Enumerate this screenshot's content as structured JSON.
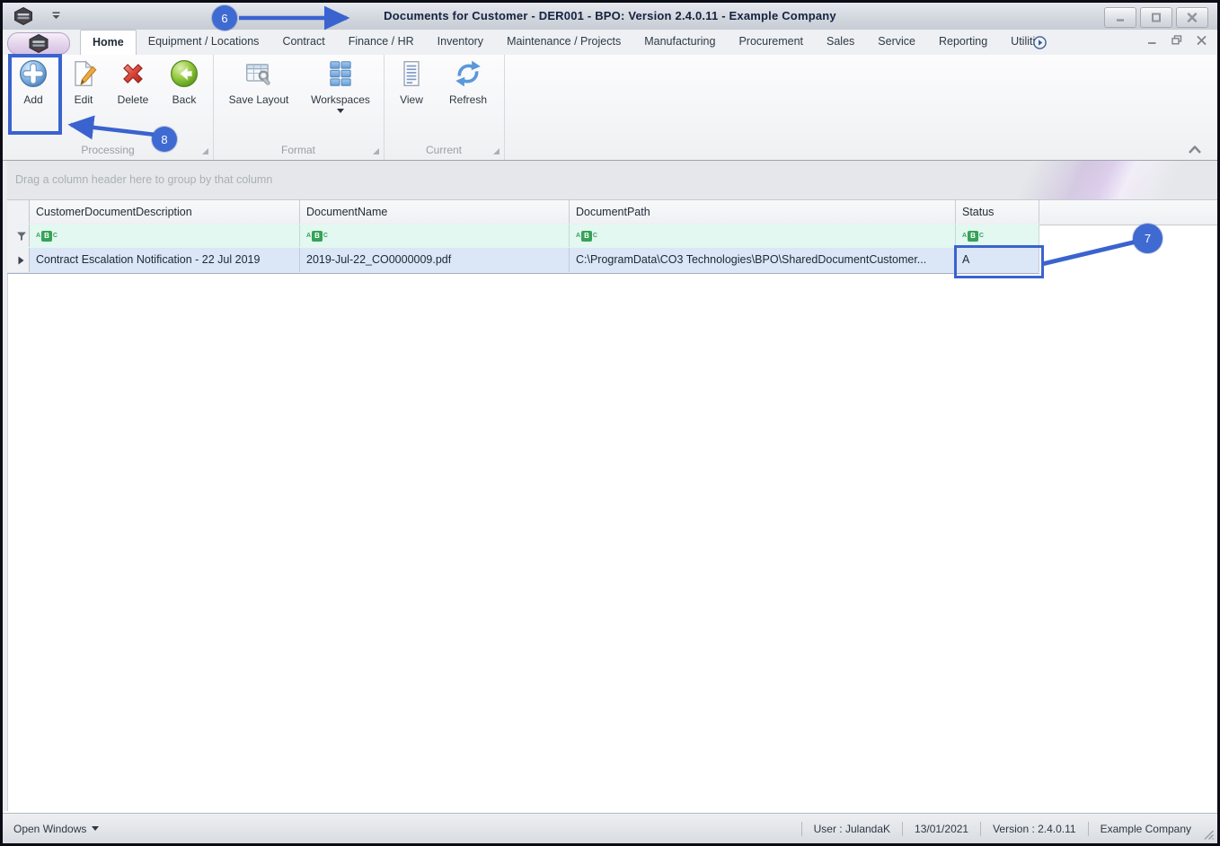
{
  "colors": {
    "annotation_blue": "#3a63cf",
    "filter_row_bg": "#e2f8f0",
    "selected_row_bg": "#dbe6f6",
    "filter_badge_green": "#36a257",
    "title_text": "#15233f",
    "window_frame": "#0c0c16"
  },
  "icons": {
    "app_logo": "bpo-hexagon-logo",
    "quick_access_caret": "chevron-down",
    "minimize": "minus-glyph",
    "maximize": "square-glyph",
    "close": "x-glyph",
    "tab_scroll": "circled-right-arrow",
    "add": "blue-sphere-plus",
    "edit": "page-with-pencil",
    "delete": "red-x",
    "back": "green-sphere-left-arrow",
    "save_layout": "table-with-wrench",
    "workspaces": "blue-tile-grid",
    "view": "document-lines",
    "refresh": "circular-arrows",
    "ribbon_collapse": "chevron-up",
    "filter_funnel": "funnel",
    "row_marker": "right-triangle",
    "abc_filter": "abc-badge",
    "resize_grip": "diagonal-grip"
  },
  "title_bar": {
    "title": "Documents for Customer - DER001 - BPO: Version 2.4.0.11 - Example Company"
  },
  "tabs": {
    "active": "Home",
    "items": [
      "Home",
      "Equipment / Locations",
      "Contract",
      "Finance / HR",
      "Inventory",
      "Maintenance / Projects",
      "Manufacturing",
      "Procurement",
      "Sales",
      "Service",
      "Reporting",
      "Utiliti"
    ]
  },
  "ribbon": {
    "groups": [
      {
        "label": "Processing",
        "buttons": [
          {
            "label": "Add"
          },
          {
            "label": "Edit"
          },
          {
            "label": "Delete"
          },
          {
            "label": "Back"
          }
        ]
      },
      {
        "label": "Format",
        "buttons": [
          {
            "label": "Save Layout"
          },
          {
            "label": "Workspaces"
          }
        ]
      },
      {
        "label": "Current",
        "buttons": [
          {
            "label": "View"
          },
          {
            "label": "Refresh"
          }
        ]
      }
    ]
  },
  "grid": {
    "group_by_hint": "Drag a column header here to group by that column",
    "columns": [
      "CustomerDocumentDescription",
      "DocumentName",
      "DocumentPath",
      "Status"
    ],
    "filter_badge": {
      "a": "A",
      "b": "B",
      "c": "C"
    },
    "rows": [
      {
        "customer_document_description": "Contract Escalation Notification - 22 Jul 2019",
        "document_name": "2019-Jul-22_CO0000009.pdf",
        "document_path": "C:\\ProgramData\\CO3 Technologies\\BPO\\SharedDocumentCustomer...",
        "status": "A"
      }
    ]
  },
  "status_bar": {
    "open_windows_label": "Open Windows",
    "items": [
      "User : JulandaK",
      "13/01/2021",
      "Version : 2.4.0.11",
      "Example Company"
    ]
  },
  "annotations": {
    "callouts": [
      "6",
      "7",
      "8"
    ]
  }
}
